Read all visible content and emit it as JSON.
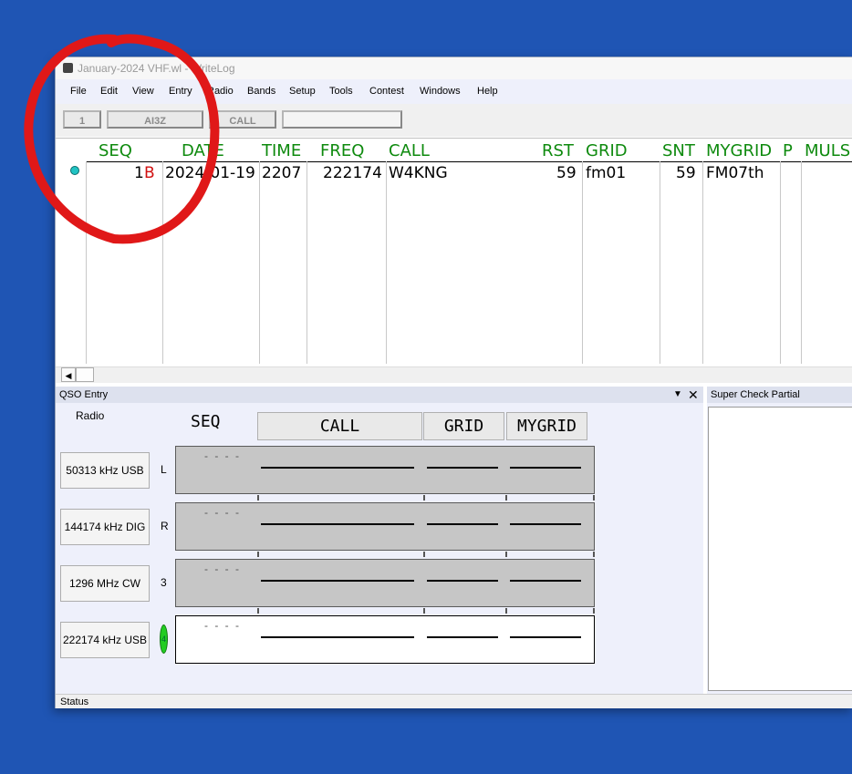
{
  "window": {
    "title": "January-2024 VHF.wl - WriteLog"
  },
  "menu": [
    "File",
    "Edit",
    "View",
    "Entry",
    "Radio",
    "Bands",
    "Setup",
    "Tools",
    "Contest",
    "Windows",
    "Help"
  ],
  "toolbar": {
    "field1": "1",
    "field2": "AI3Z",
    "field3": "CALL",
    "field4": ""
  },
  "log": {
    "columns": [
      "SEQ",
      "DATE",
      "TIME",
      "FREQ",
      "CALL",
      "RST",
      "GRID",
      "SNT",
      "MYGRID",
      "P",
      "MULS"
    ],
    "row": {
      "seq": "1",
      "seq_flag": "B",
      "date": "2024-01-19",
      "time": "2207",
      "freq": "222174",
      "call": "W4KNG",
      "rst": "59",
      "grid": "fm01",
      "snt": "59",
      "mygrid": "FM07th"
    }
  },
  "qso_entry": {
    "title": "QSO Entry",
    "radio_label": "Radio",
    "seq_label": "SEQ",
    "call_label": "CALL",
    "grid_label": "GRID",
    "mygrid_label": "MYGRID",
    "seq_placeholder": "- - - -",
    "radios": [
      {
        "button": "50313 kHz USB",
        "letter": "L"
      },
      {
        "button": "144174 kHz DIG",
        "letter": "R"
      },
      {
        "button": "1296 MHz CW",
        "letter": "3"
      },
      {
        "button": "222174 kHz USB",
        "letter": "4"
      }
    ]
  },
  "super_check": {
    "title": "Super Check Partial"
  },
  "status": {
    "text": "Status"
  },
  "colors": {
    "desktop": "#1f55b4",
    "header_green": "#0e8a0e",
    "annotation_red": "#e01818",
    "flag_red": "#d01010"
  }
}
